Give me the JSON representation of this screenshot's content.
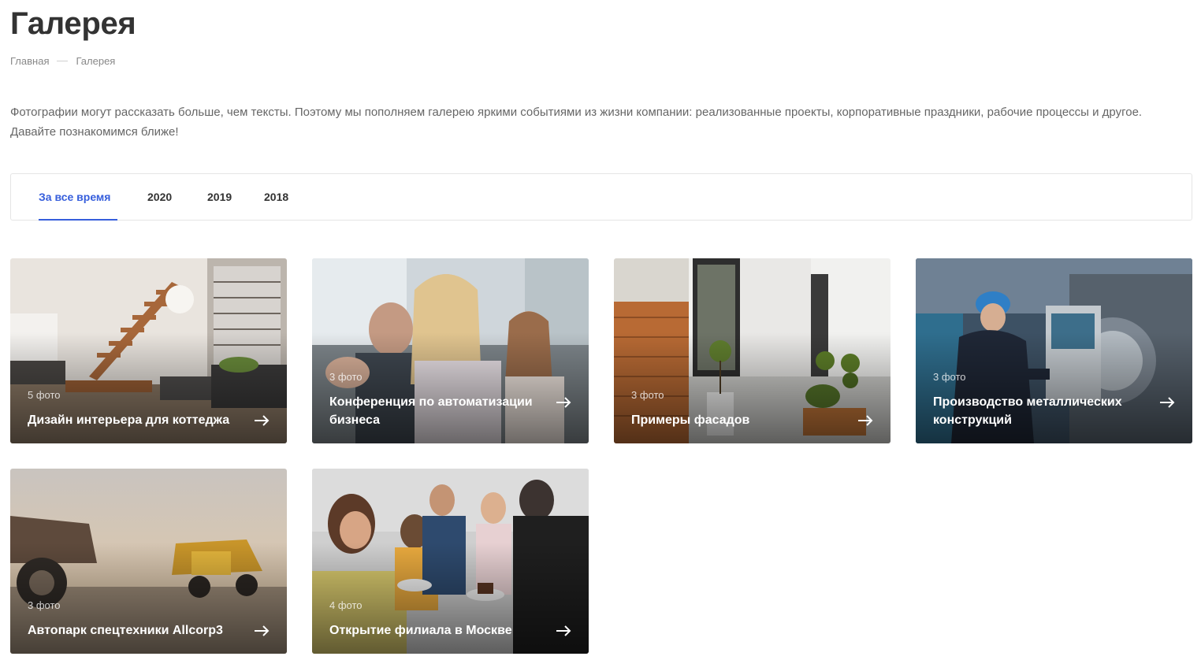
{
  "page": {
    "title": "Галерея",
    "breadcrumb": [
      "Главная",
      "Галерея"
    ],
    "intro": "Фотографии могут рассказать больше, чем тексты. Поэтому мы пополняем галерею яркими событиями из жизни компании: реализованные проекты, корпоративные праздники, рабочие процессы и другое. Давайте познакомимся ближе!"
  },
  "tabs": [
    {
      "label": "За все время",
      "active": true
    },
    {
      "label": "2020",
      "active": false
    },
    {
      "label": "2019",
      "active": false
    },
    {
      "label": "2018",
      "active": false
    }
  ],
  "cards": [
    {
      "count": "5 фото",
      "title": "Дизайн интерьера для коттеджа",
      "image": "interior-photo"
    },
    {
      "count": "3 фото",
      "title": "Конференция по автоматизации бизнеса",
      "image": "conference-photo"
    },
    {
      "count": "3 фото",
      "title": "Примеры фасадов",
      "image": "facade-photo"
    },
    {
      "count": "3 фото",
      "title": "Производство металлических конструкций",
      "image": "factory-photo"
    },
    {
      "count": "3 фото",
      "title": "Автопарк спецтехники Allcorp3",
      "image": "trucks-photo"
    },
    {
      "count": "4 фото",
      "title": "Открытие филиала в Москве",
      "image": "party-photo"
    }
  ],
  "icons": {
    "card_arrow": "arrow-right-icon"
  },
  "colors": {
    "accent": "#365edc",
    "text": "#333333",
    "muted": "#888888"
  }
}
